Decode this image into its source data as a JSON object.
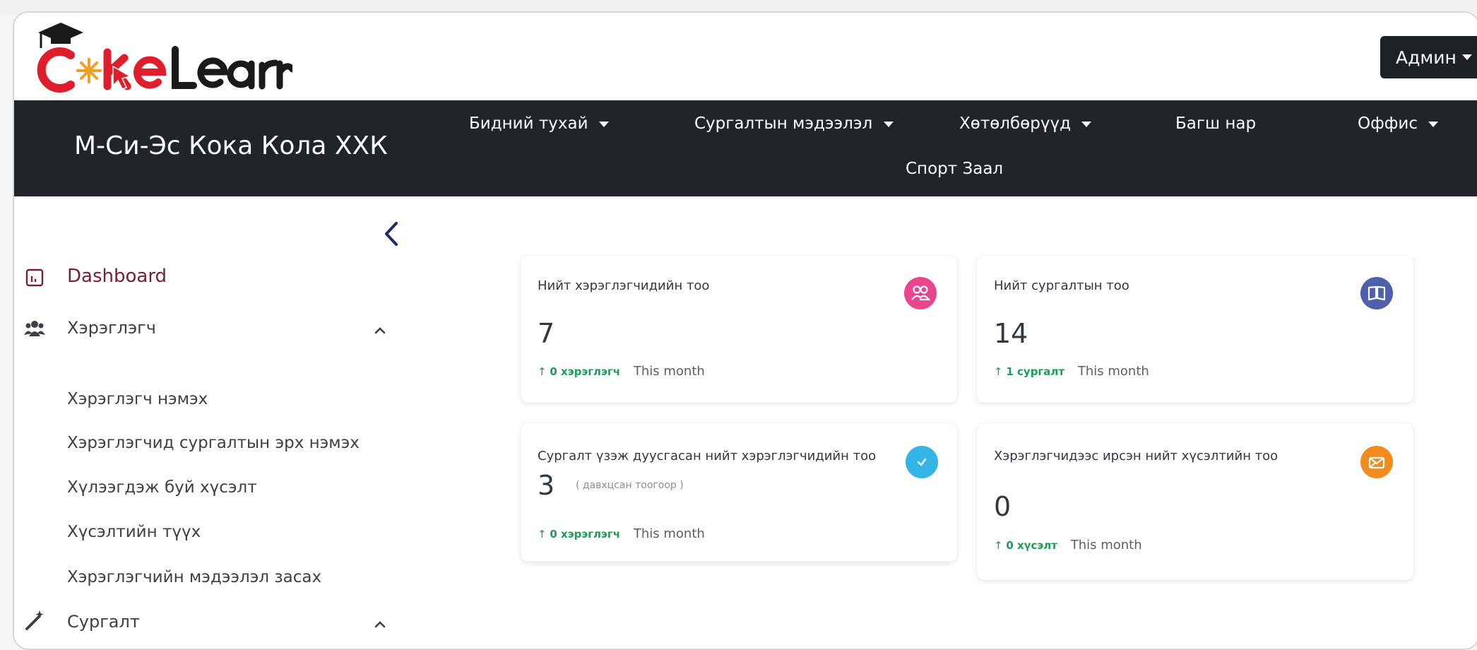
{
  "brand": {
    "logo_text": "CokeLearn"
  },
  "header": {
    "admin_label": "Админ"
  },
  "nav": {
    "company": "М-Си-Эс Кока Кола ХХК",
    "items": [
      "Бидний тухай",
      "Сургалтын мэдээлэл",
      "Хөтөлбөрүүд",
      "Багш нар",
      "Оффис",
      "Спорт Заал"
    ]
  },
  "sidebar": {
    "dashboard": "Dashboard",
    "users": "Хэрэглэгч",
    "user_sub": [
      "Хэрэглэгч нэмэх",
      "Хэрэглэгчид сургалтын эрх нэмэх",
      "Хүлээгдэж буй хүсэлт",
      "Хүсэлтийн түүх",
      "Хэрэглэгчийн мэдээлэл засах"
    ],
    "training": "Сургалт"
  },
  "cards": [
    {
      "title": "Нийт хэрэглэгчидийн тоо",
      "value": "7",
      "change": "0 хэрэглэгч",
      "period": "This month",
      "color": "#e8468e",
      "icon": "users-icon"
    },
    {
      "title": "Нийт сургалтын тоо",
      "value": "14",
      "change": "1 сургалт",
      "period": "This month",
      "color": "#4e5fae",
      "icon": "book-icon"
    },
    {
      "title": "Сургалт үзэж дуусгасан нийт хэрэглэгчидийн тоо",
      "value": "3",
      "note": "( давхцсан тоогоор )",
      "change": "0 хэрэглэгч",
      "period": "This month",
      "color": "#33b5e5",
      "icon": "check-icon"
    },
    {
      "title": "Хэрэглэгчидээс ирсэн нийт хүсэлтийн тоо",
      "value": "0",
      "change": "0 хүсэлт",
      "period": "This month",
      "color": "#f28b1e",
      "icon": "mail-icon"
    }
  ],
  "colors": {
    "nav_bg": "#212529",
    "accent_red": "#e01d2b",
    "dashboard_text": "#7a1f33"
  }
}
